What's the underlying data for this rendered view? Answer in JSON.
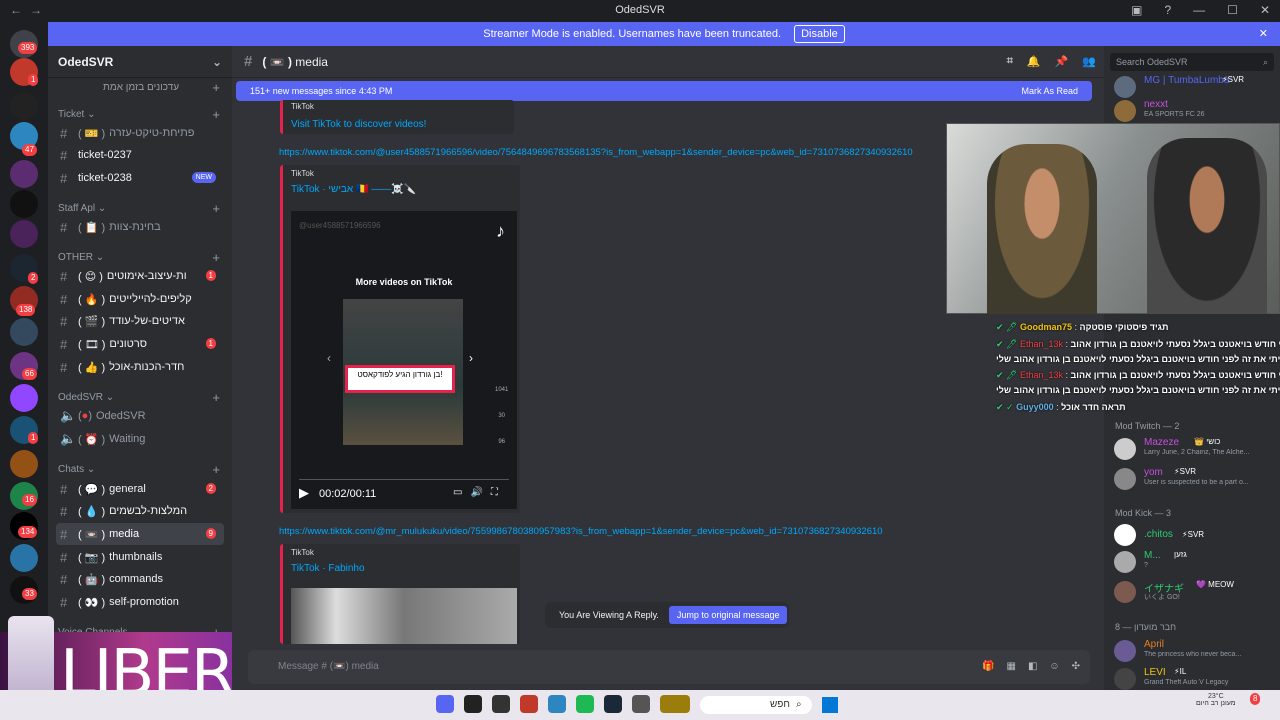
{
  "window": {
    "title": "OdedSVR",
    "back": "←",
    "forward": "→"
  },
  "streamer": {
    "text": "Streamer Mode is enabled. Usernames have been truncated.",
    "disable_label": "Disable",
    "close": "✕"
  },
  "guild_badges": [
    "393",
    "1",
    "47",
    "2",
    "138",
    "66",
    "1",
    "16",
    "134",
    "33"
  ],
  "server": {
    "name": "OdedSVR"
  },
  "channels": {
    "top_item": "עדכונים בזמן אמת",
    "cat_ticket": "Ticket",
    "open_ticket": "פתיחת-טיקט-עזרה",
    "ticket1": "ticket-0237",
    "ticket2": "ticket-0238",
    "new_badge": "NEW",
    "cat_staff": "Staff Apl",
    "staff_test": "בחינת-צוות",
    "cat_other": "OTHER",
    "other1": "ות-עיצוב-אימוטים",
    "other1_count": "1",
    "other2": "קליפים-להיילייטים",
    "other3": "אדיטים-של-עודד",
    "other4": "סרטונים",
    "other4_count": "1",
    "other5": "חדר-הכנות-אוכל",
    "cat_odedsvr": "OdedSVR",
    "voice1": "OdedSVR",
    "voice2": "Waiting",
    "cat_chats": "Chats",
    "general": "general",
    "general_count": "2",
    "recs": "המלצות-לבשמים",
    "media": "media",
    "media_count": "9",
    "thumbnails": "thumbnails",
    "commands": "commands",
    "selfpromo": "self-promotion",
    "cat_voice": "Voice Channels"
  },
  "overlay": {
    "libero": "LIBERO"
  },
  "header": {
    "channel": "media",
    "search_placeholder": "Search OdedSVR"
  },
  "newmsg": {
    "text": "151+ new messages since 4:43 PM",
    "mark": "Mark As Read"
  },
  "messages": {
    "embed1_label": "TikTok",
    "embed1_title": "Visit TikTok to discover videos!",
    "link1": "https://www.tiktok.com/@user4588571966596/video/7564849696783568135?is_from_webapp=1&sender_device=pc&web_id=7310736827340932610",
    "embed2_label": "TikTok",
    "embed2_title": "TikTok · אבישי 🇷🇴 ——☠️🔪",
    "video_more": "More videos on TikTok",
    "video_caption": "בן גורדון הגיע לפודקאסט!",
    "video_time": "00:02/00:11",
    "video_likes": "1041",
    "video_comments": "30",
    "video_shares": "96",
    "video_user": "@user4588571966596",
    "link2": "https://www.tiktok.com/@mr_mulukuku/video/7559986780380957983?is_from_webapp=1&sender_device=pc&web_id=7310736827340932610",
    "embed3_label": "TikTok",
    "embed3_title": "TikTok · Fabinho"
  },
  "reply": {
    "text": "You Are Viewing A Reply.",
    "jump": "Jump to original message"
  },
  "composer": {
    "placeholder": "Message # (📼) media"
  },
  "members": {
    "top": [
      {
        "name": "MG | TumbaLumba",
        "tag": "⚡SVR",
        "status": ""
      },
      {
        "name": "nexxt",
        "tag": "",
        "status": "EA SPORTS FC 26"
      }
    ],
    "mod_twitch": "Mod Twitch — 2",
    "twitch": [
      {
        "name": "Mazeze",
        "tag": "👑 כושי",
        "status": "Larry June, 2 Chainz, The Alche..."
      },
      {
        "name": "yom",
        "tag": "⚡SVR",
        "status": "User is suspected to be a part o..."
      }
    ],
    "mod_kick": "Mod Kick — 3",
    "kick": [
      {
        "name": ".chitos",
        "tag": "⚡SVR",
        "status": ""
      },
      {
        "name": "M...",
        "tag": "גזען",
        "status": "?"
      },
      {
        "name": "イザナギ",
        "tag": "💜 MEOW",
        "status": "いくよ GO!"
      }
    ],
    "friends": "חבר מועדון — 8",
    "friend_list": [
      {
        "name": "April",
        "tag": "",
        "status": "The princess who never beca..."
      },
      {
        "name": "LEVI",
        "tag": "⚡IL",
        "status": "Grand Theft Auto V Legacy"
      }
    ]
  },
  "stream_chat": [
    {
      "user": "Goodman75",
      "msg": "תגיד פיסטוקי פוסטקה"
    },
    {
      "user": "Ethan_13k",
      "msg": "פני חודש בויאטנט ביגלל נסעתי לויאטנם בן גורדון אהוב"
    },
    {
      "user": "",
      "msg": "שיתי את זה לפני חודש בויאטנם ביגלל נסעתי לויאטנם בן גורדון אהוב שלי"
    },
    {
      "user": "Ethan_13k",
      "msg": "פני חודש בויאטנט ביגלל נסעתי לויאטנם בן גורדון אהוב"
    },
    {
      "user": "",
      "msg": "שיתי את זה לפני חודש בויאטנם ביגלל נסעתי לויאטנם בן גורדון אהוב שלי"
    },
    {
      "user": "Guyy000",
      "msg": "תראה חדר אוכל"
    }
  ],
  "taskbar": {
    "search": "חפש",
    "temp": "23°C",
    "weather": "מעונן רב היום",
    "notif": "8"
  },
  "colors": {
    "accent": "#5865f2",
    "mention": "#f23f43",
    "link": "#00a8fc"
  }
}
